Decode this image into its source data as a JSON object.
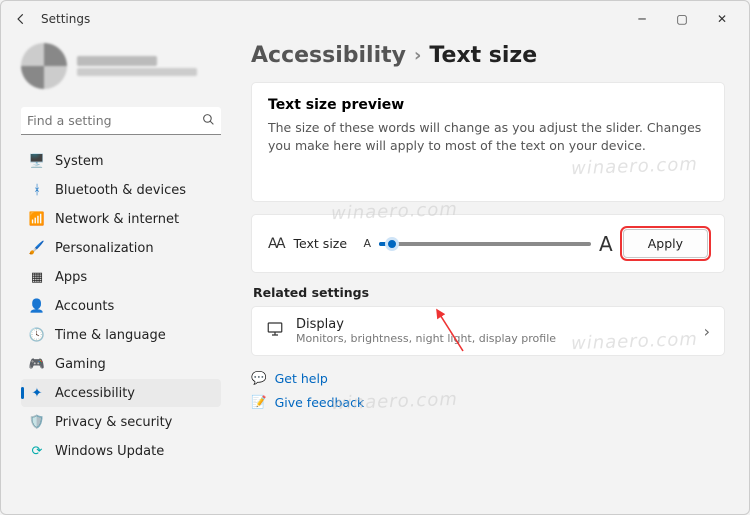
{
  "window": {
    "title": "Settings"
  },
  "user": {
    "name_redacted": true
  },
  "search": {
    "placeholder": "Find a setting"
  },
  "sidebar": {
    "items": [
      {
        "label": "System"
      },
      {
        "label": "Bluetooth & devices"
      },
      {
        "label": "Network & internet"
      },
      {
        "label": "Personalization"
      },
      {
        "label": "Apps"
      },
      {
        "label": "Accounts"
      },
      {
        "label": "Time & language"
      },
      {
        "label": "Gaming"
      },
      {
        "label": "Accessibility"
      },
      {
        "label": "Privacy & security"
      },
      {
        "label": "Windows Update"
      }
    ],
    "active_index": 8
  },
  "breadcrumb": {
    "parent": "Accessibility",
    "current": "Text size"
  },
  "preview": {
    "heading": "Text size preview",
    "body": "The size of these words will change as you adjust the slider. Changes you make here will apply to most of the text on your device."
  },
  "slider": {
    "label": "Text size",
    "min_glyph": "A",
    "max_glyph": "A",
    "apply_label": "Apply",
    "value_percent": 6
  },
  "related": {
    "heading": "Related settings",
    "display": {
      "title": "Display",
      "subtitle": "Monitors, brightness, night light, display profile"
    }
  },
  "links": {
    "help": "Get help",
    "feedback": "Give feedback"
  },
  "watermark_text": "winaero.com",
  "annotation": {
    "apply_highlight_color": "#e33",
    "arrow_color": "#e33"
  }
}
